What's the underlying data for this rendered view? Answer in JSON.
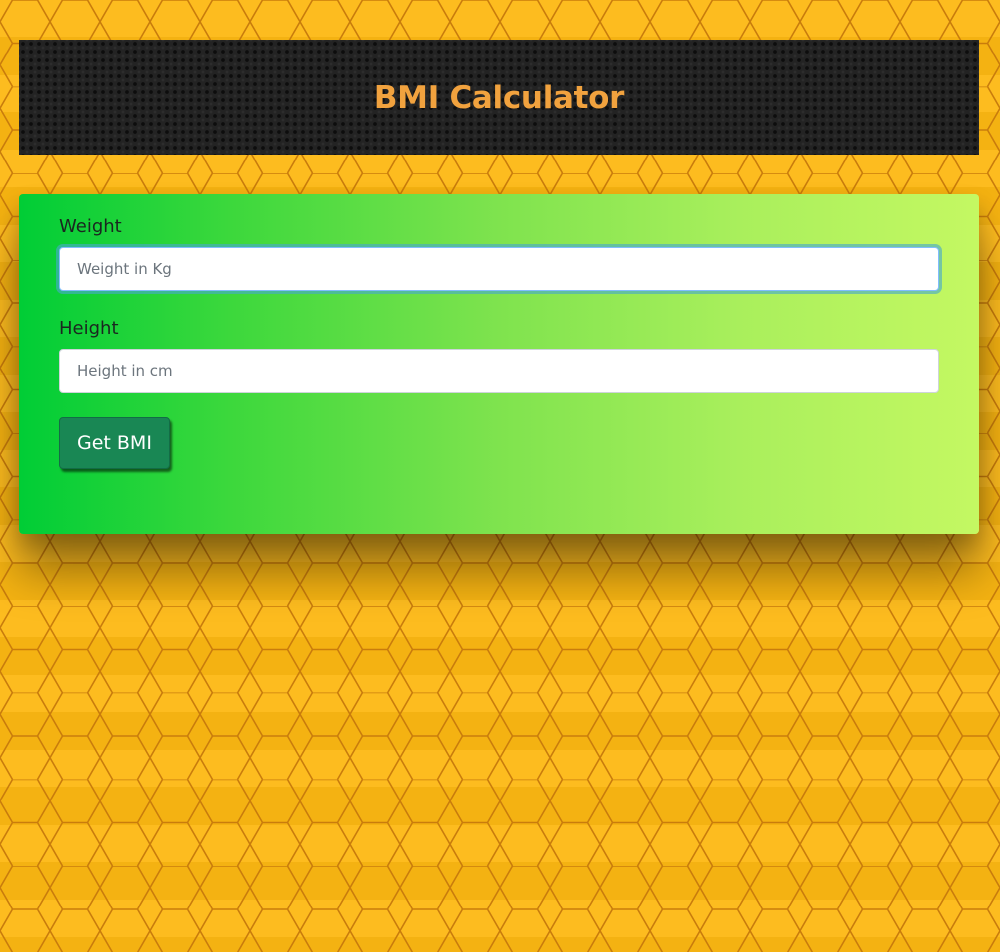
{
  "header": {
    "title": "BMI Calculator"
  },
  "form": {
    "weight": {
      "label": "Weight",
      "placeholder": "Weight in Kg",
      "value": ""
    },
    "height": {
      "label": "Height",
      "placeholder": "Height in cm",
      "value": ""
    },
    "submit_label": "Get BMI"
  },
  "colors": {
    "background": "#fdb813",
    "hex_lines": "#c97c0c",
    "header_bg": "#232323",
    "title": "#f1a23e",
    "card_gradient_start": "#00cd36",
    "card_gradient_end": "#c4f862",
    "button": "#198754"
  }
}
